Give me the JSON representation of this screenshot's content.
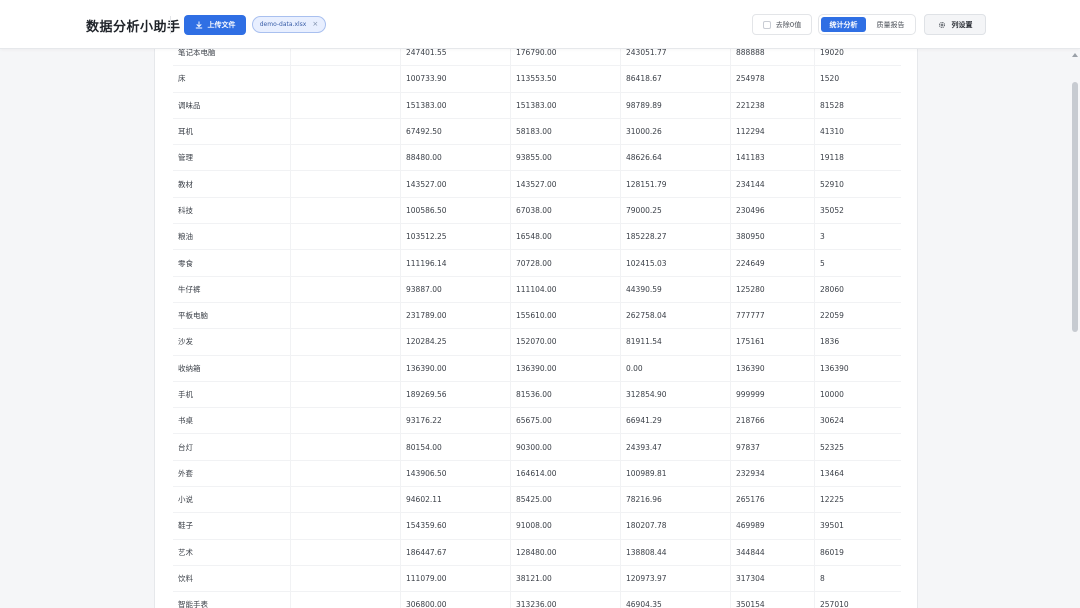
{
  "header": {
    "app_title": "数据分析小助手",
    "upload_label": "上传文件",
    "file_chip": {
      "name": "demo-data.xlsx",
      "close": "×"
    },
    "remove_zero_label": "去除0值",
    "modes": [
      {
        "label": "统计分析",
        "active": true
      },
      {
        "label": "质量报告",
        "active": false
      }
    ],
    "column_settings_label": "列设置"
  },
  "table": {
    "rows": [
      [
        "笔记本电脑",
        "",
        "247401.55",
        "176790.00",
        "243051.77",
        "888888",
        "19020"
      ],
      [
        "床",
        "",
        "100733.90",
        "113553.50",
        "86418.67",
        "254978",
        "1520"
      ],
      [
        "调味品",
        "",
        "151383.00",
        "151383.00",
        "98789.89",
        "221238",
        "81528"
      ],
      [
        "耳机",
        "",
        "67492.50",
        "58183.00",
        "31000.26",
        "112294",
        "41310"
      ],
      [
        "管理",
        "",
        "88480.00",
        "93855.00",
        "48626.64",
        "141183",
        "19118"
      ],
      [
        "教材",
        "",
        "143527.00",
        "143527.00",
        "128151.79",
        "234144",
        "52910"
      ],
      [
        "科技",
        "",
        "100586.50",
        "67038.00",
        "79000.25",
        "230496",
        "35052"
      ],
      [
        "粮油",
        "",
        "103512.25",
        "16548.00",
        "185228.27",
        "380950",
        "3"
      ],
      [
        "零食",
        "",
        "111196.14",
        "70728.00",
        "102415.03",
        "224649",
        "5"
      ],
      [
        "牛仔裤",
        "",
        "93887.00",
        "111104.00",
        "44390.59",
        "125280",
        "28060"
      ],
      [
        "平板电脑",
        "",
        "231789.00",
        "155610.00",
        "262758.04",
        "777777",
        "22059"
      ],
      [
        "沙发",
        "",
        "120284.25",
        "152070.00",
        "81911.54",
        "175161",
        "1836"
      ],
      [
        "收纳箱",
        "",
        "136390.00",
        "136390.00",
        "0.00",
        "136390",
        "136390"
      ],
      [
        "手机",
        "",
        "189269.56",
        "81536.00",
        "312854.90",
        "999999",
        "10000"
      ],
      [
        "书桌",
        "",
        "93176.22",
        "65675.00",
        "66941.29",
        "218766",
        "30624"
      ],
      [
        "台灯",
        "",
        "80154.00",
        "90300.00",
        "24393.47",
        "97837",
        "52325"
      ],
      [
        "外套",
        "",
        "143906.50",
        "164614.00",
        "100989.81",
        "232934",
        "13464"
      ],
      [
        "小说",
        "",
        "94602.11",
        "85425.00",
        "78216.96",
        "265176",
        "12225"
      ],
      [
        "鞋子",
        "",
        "154359.60",
        "91008.00",
        "180207.78",
        "469989",
        "39501"
      ],
      [
        "艺术",
        "",
        "186447.67",
        "128480.00",
        "138808.44",
        "344844",
        "86019"
      ],
      [
        "饮料",
        "",
        "111079.00",
        "38121.00",
        "120973.97",
        "317304",
        "8"
      ],
      [
        "智能手表",
        "",
        "306800.00",
        "313236.00",
        "46904.35",
        "350154",
        "257010"
      ]
    ]
  }
}
